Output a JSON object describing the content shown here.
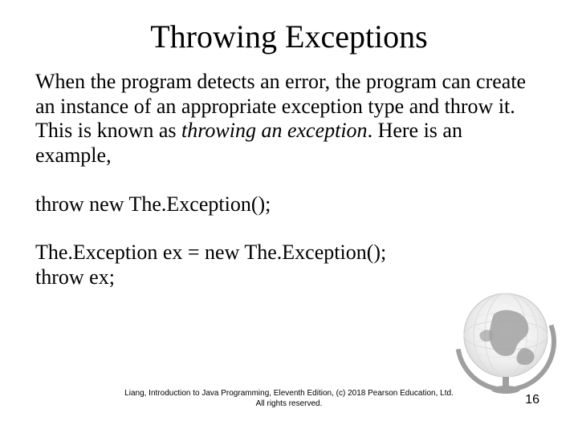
{
  "title": "Throwing Exceptions",
  "para1_pre": "When the program detects an error, the program can create an instance of an appropriate exception type and throw it. This is known as ",
  "para1_italic": "throwing an exception",
  "para1_post": ". Here is an example,",
  "code1": "throw new The.Exception();",
  "code2_line1": "The.Exception ex = new The.Exception();",
  "code2_line2": "throw ex;",
  "footer_line1": "Liang, Introduction to Java Programming, Eleventh Edition, (c) 2018 Pearson Education, Ltd.",
  "footer_line2": "All rights reserved.",
  "page_number": "16"
}
